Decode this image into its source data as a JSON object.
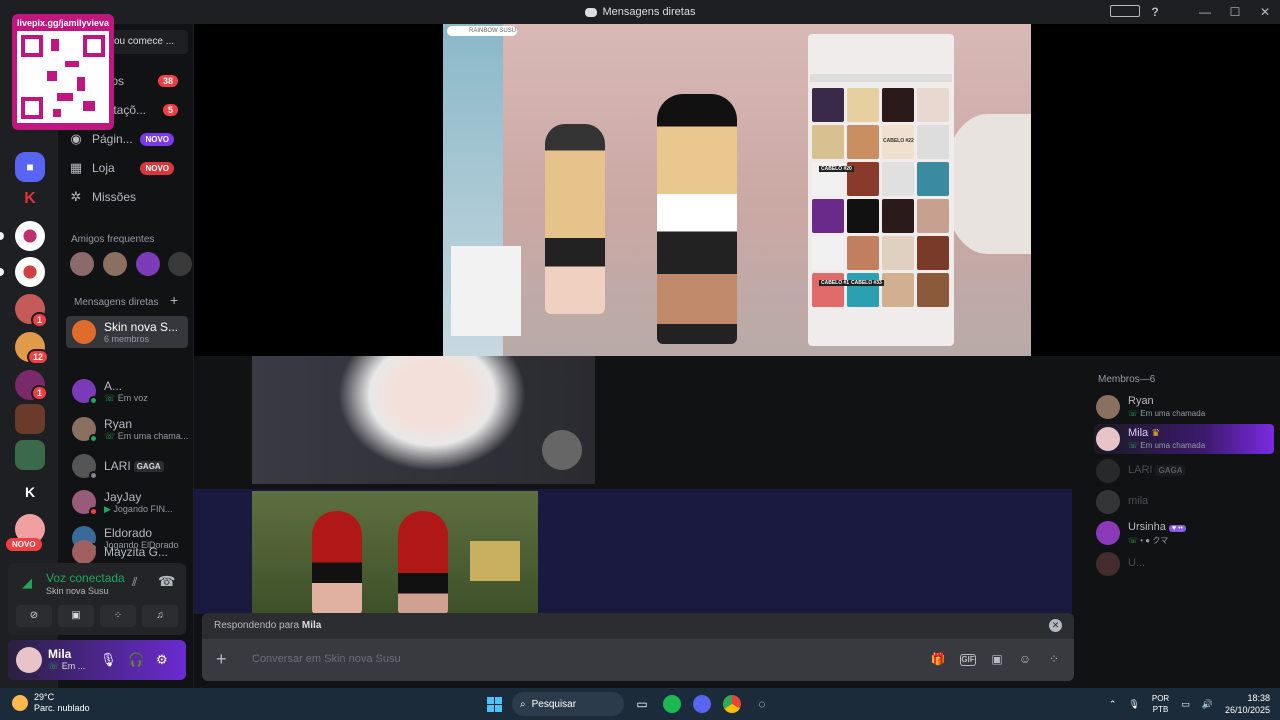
{
  "window": {
    "title": "Mensagens diretas"
  },
  "qr": {
    "url_text": "livepix.gg/jamilyvieva"
  },
  "sidebar": {
    "search_text": "ou comece ...",
    "nav": [
      {
        "label": "Amigos",
        "badge": "38"
      },
      {
        "label": "Solicitações",
        "badge": "5"
      },
      {
        "label": "Página...",
        "badge": "NOVO"
      },
      {
        "label": "Loja",
        "badge": "NOVO"
      },
      {
        "label": "Missões",
        "badge": ""
      }
    ],
    "nav_display": [
      "...igos",
      "...icitaçõ...",
      "Págin...",
      "Loja",
      "Missões"
    ],
    "frequent_header": "Amigos frequentes",
    "dm_header": "Mensagens diretas",
    "dms": [
      {
        "name": "Skin nova S...",
        "sub": "6 membros",
        "color": "#e06b2b"
      },
      {
        "name": "A...",
        "sub": "Em voz",
        "color": "#7b3ab8"
      },
      {
        "name": "Ryan",
        "sub": "Em uma chama...",
        "color": "#8a7060"
      },
      {
        "name": "LARI",
        "tag": "GAGA",
        "sub": "",
        "color": "#555"
      },
      {
        "name": "JayJay",
        "sub": "Jogando FIN...",
        "color": "#9a5a7a"
      },
      {
        "name": "Eldorado",
        "sub": "Jogando ElDorado",
        "color": "#3a6a9a"
      },
      {
        "name": "Mayzita G...",
        "sub": "",
        "color": "#a06060"
      }
    ]
  },
  "rail": {
    "badges": [
      "1",
      "12",
      "1"
    ],
    "novo": "NOVO"
  },
  "voice": {
    "title": "Voz conectada",
    "channel": "Skin nova Susu"
  },
  "user": {
    "name": "Mila",
    "status": "Em ..."
  },
  "reply": {
    "prefix": "Respondendo para",
    "target": "Mila"
  },
  "composer": {
    "placeholder": "Conversar em Skin nova Susu"
  },
  "members": {
    "header": "Membros—6",
    "list": [
      {
        "name": "Ryan",
        "sub": "Em uma chamada",
        "color": "#8a7060",
        "dim": false
      },
      {
        "name": "Mila",
        "sub": "Em uma chamada",
        "color": "#e8c3c8",
        "dim": false
      },
      {
        "name": "LARI",
        "tag": "GAGA",
        "sub": "",
        "color": "#555",
        "dim": true
      },
      {
        "name": "mila",
        "sub": "",
        "color": "#777",
        "dim": true
      },
      {
        "name": "Ursinha",
        "sub": "• ● クマ",
        "color": "#8a3ab8",
        "dim": false
      },
      {
        "name": "U...",
        "sub": "",
        "color": "#a06060",
        "dim": true
      }
    ]
  },
  "taskbar": {
    "weather_temp": "29°C",
    "weather_desc": "Parc. nublado",
    "search": "Pesquisar",
    "lang_1": "POR",
    "lang_2": "PTB",
    "time": "18:38",
    "date": "26/10/2025"
  },
  "stream": {
    "header_label": "RAINBOW SUSU",
    "hair_labels": [
      "CABELO #22",
      "CABELO #20",
      "CABELO #14",
      "CABELO #33"
    ]
  }
}
